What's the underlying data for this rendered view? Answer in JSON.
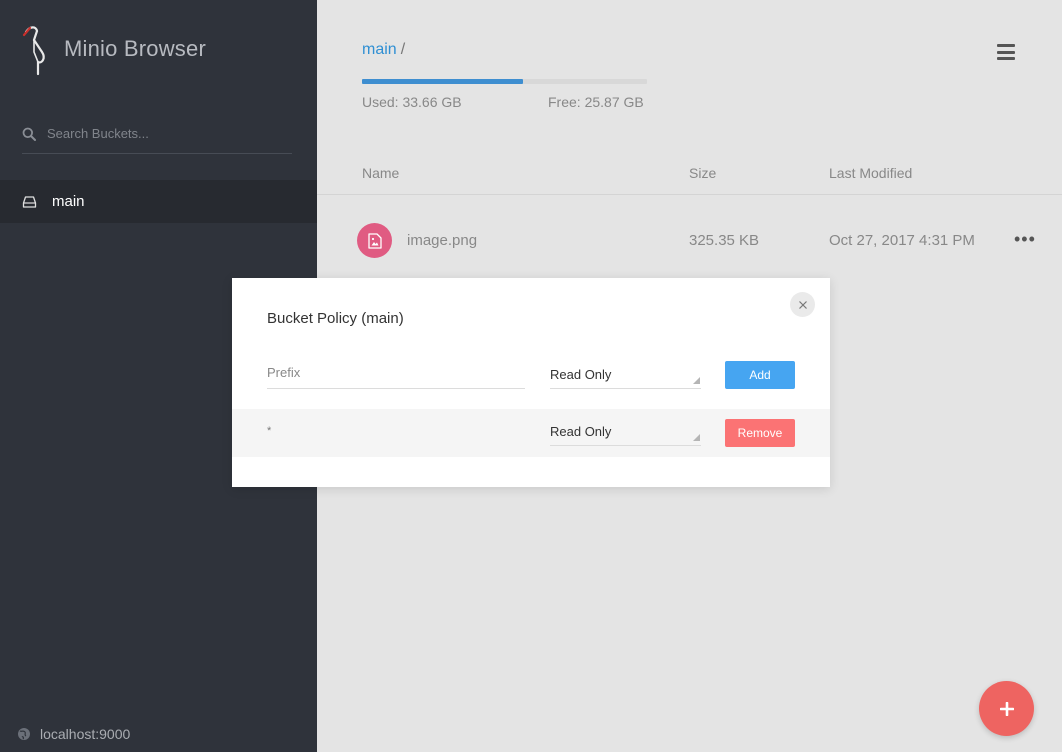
{
  "app": {
    "name": "Minio Browser"
  },
  "sidebar": {
    "search_placeholder": "Search Buckets...",
    "buckets": [
      {
        "label": "main",
        "active": true
      }
    ],
    "host": "localhost:9000"
  },
  "header": {
    "breadcrumb": {
      "bucket": "main",
      "separator": "/"
    },
    "storage": {
      "used": "Used: 33.66 GB",
      "free": "Free: 25.87 GB",
      "used_fraction": 0.565
    }
  },
  "table": {
    "columns": [
      "Name",
      "Size",
      "Last Modified"
    ],
    "rows": [
      {
        "name": "image.png",
        "size": "325.35 KB",
        "modified": "Oct 27, 2017 4:31 PM",
        "actions": "•••"
      }
    ]
  },
  "modal": {
    "title": "Bucket Policy (main)",
    "prefix_placeholder": "Prefix",
    "new_policy": {
      "value": "Read Only",
      "button": "Add"
    },
    "policies": [
      {
        "prefix": "*",
        "value": "Read Only",
        "button": "Remove"
      }
    ]
  },
  "colors": {
    "sidebar_bg": "#2f333b",
    "accent": "#2f8fd3",
    "add_button": "#46a5f1",
    "remove_button": "#fb7374",
    "fab": "#ee6461",
    "file_icon": "#e05b82"
  },
  "icons": {
    "logo": "minio-bird-logo",
    "search": "search-icon",
    "bucket": "hard-drive-icon",
    "host": "globe-icon",
    "menu": "hamburger-menu-icon",
    "file": "image-file-icon",
    "close": "close-icon",
    "fab": "plus-icon"
  }
}
